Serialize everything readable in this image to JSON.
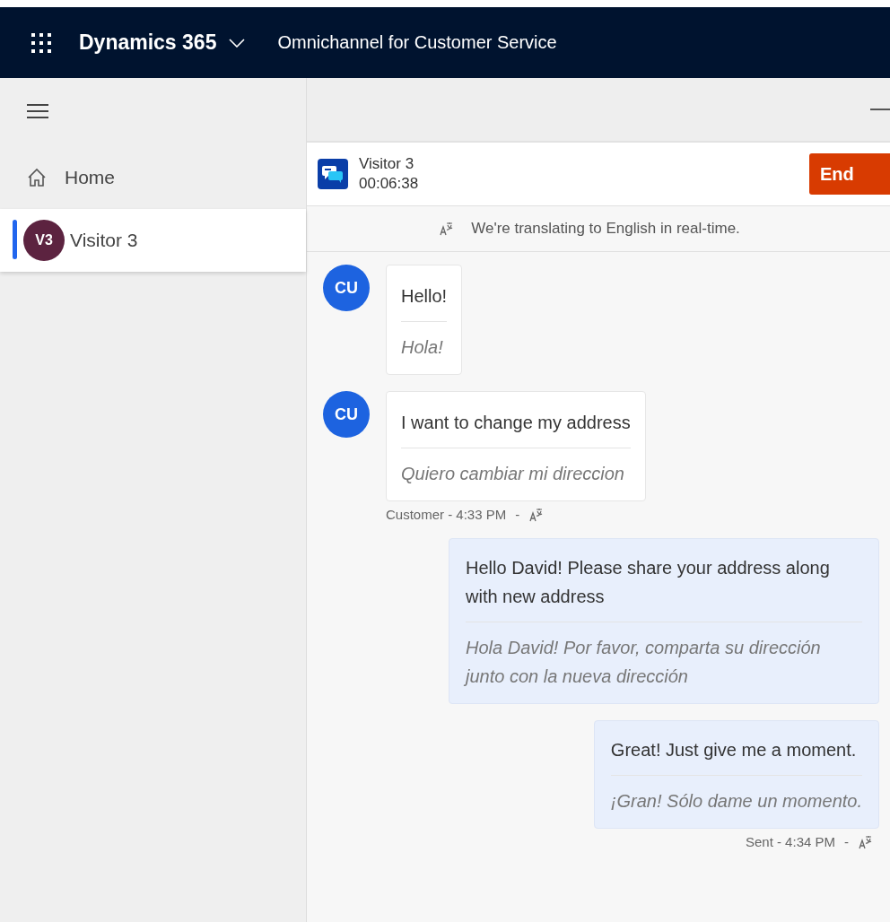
{
  "top_bar": {
    "app_name": "Dynamics 365",
    "area": "Omnichannel for Customer Service"
  },
  "sidebar": {
    "items": [
      {
        "kind": "home",
        "label": "Home",
        "selected": false
      },
      {
        "kind": "session",
        "label": "Visitor 3",
        "initials": "V3",
        "color": "#5c2340",
        "selected": true
      }
    ]
  },
  "session": {
    "name": "Visitor 3",
    "timer": "00:06:38",
    "end_button": "End"
  },
  "translation_banner": "We're translating to English in real-time.",
  "messages": [
    {
      "kind": "incoming",
      "avatar": "CU",
      "text": "Hello!",
      "translation": "Hola!"
    },
    {
      "kind": "incoming",
      "avatar": "CU",
      "text": "I want to change my address",
      "translation": "Quiero cambiar mi direccion",
      "meta": "Customer - 4:33 PM",
      "separator": "-"
    },
    {
      "kind": "outgoing",
      "text": "Hello David! Please share your address along with new address",
      "translation": "Hola David! Por favor, comparta su dirección junto con la nueva dirección"
    },
    {
      "kind": "outgoing",
      "text": "Great! Just give me a moment.",
      "translation": "¡Gran! Sólo dame un momento.",
      "meta": "Sent - 4:34 PM",
      "separator": "-"
    }
  ]
}
